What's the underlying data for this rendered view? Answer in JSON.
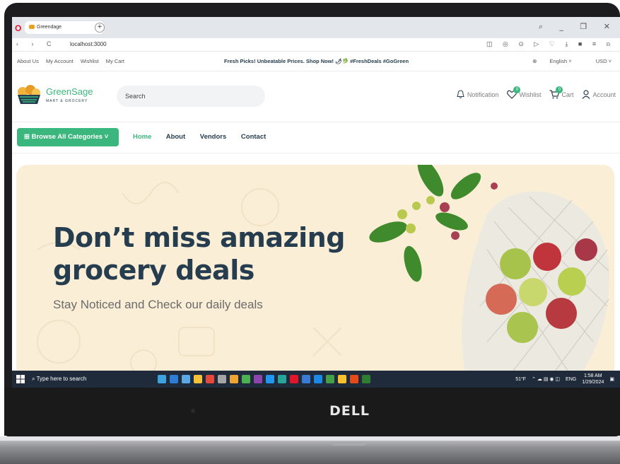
{
  "browser": {
    "tab_title": "Greendage",
    "url": "localhost:3000"
  },
  "utility_bar": {
    "links": [
      "About Us",
      "My Account",
      "Wishlist",
      "My Cart"
    ],
    "promo": "Fresh Picks! Unbeatable Prices. Shop Now! 🌶🥬 #FreshDeals #GoGreen",
    "language": "English",
    "currency": "USD"
  },
  "header": {
    "logo_name": "GreenSage",
    "logo_sub": "MART & GROCERY",
    "search_placeholder": "Search",
    "notification_label": "Notification",
    "wishlist_label": "Wishlist",
    "wishlist_count": "0",
    "cart_label": "Cart",
    "cart_count": "0",
    "account_label": "Account"
  },
  "nav": {
    "browse_label": "Browse All Categories",
    "items": [
      "Home",
      "About",
      "Vendors",
      "Contact"
    ],
    "active": "Home"
  },
  "hero": {
    "title": "Don’t miss amazing\ngrocery deals",
    "subtitle": "Stay Noticed and Check our daily deals"
  },
  "taskbar": {
    "search_text": "Type here to search",
    "weather": "51°F",
    "lang": "ENG",
    "time": "1:58 AM",
    "date": "1/29/2024"
  },
  "device": {
    "brand": "DELL"
  },
  "colors": {
    "accent": "#3BB77E",
    "heading": "#253D4E",
    "hero_bg": "#fbeed6"
  }
}
